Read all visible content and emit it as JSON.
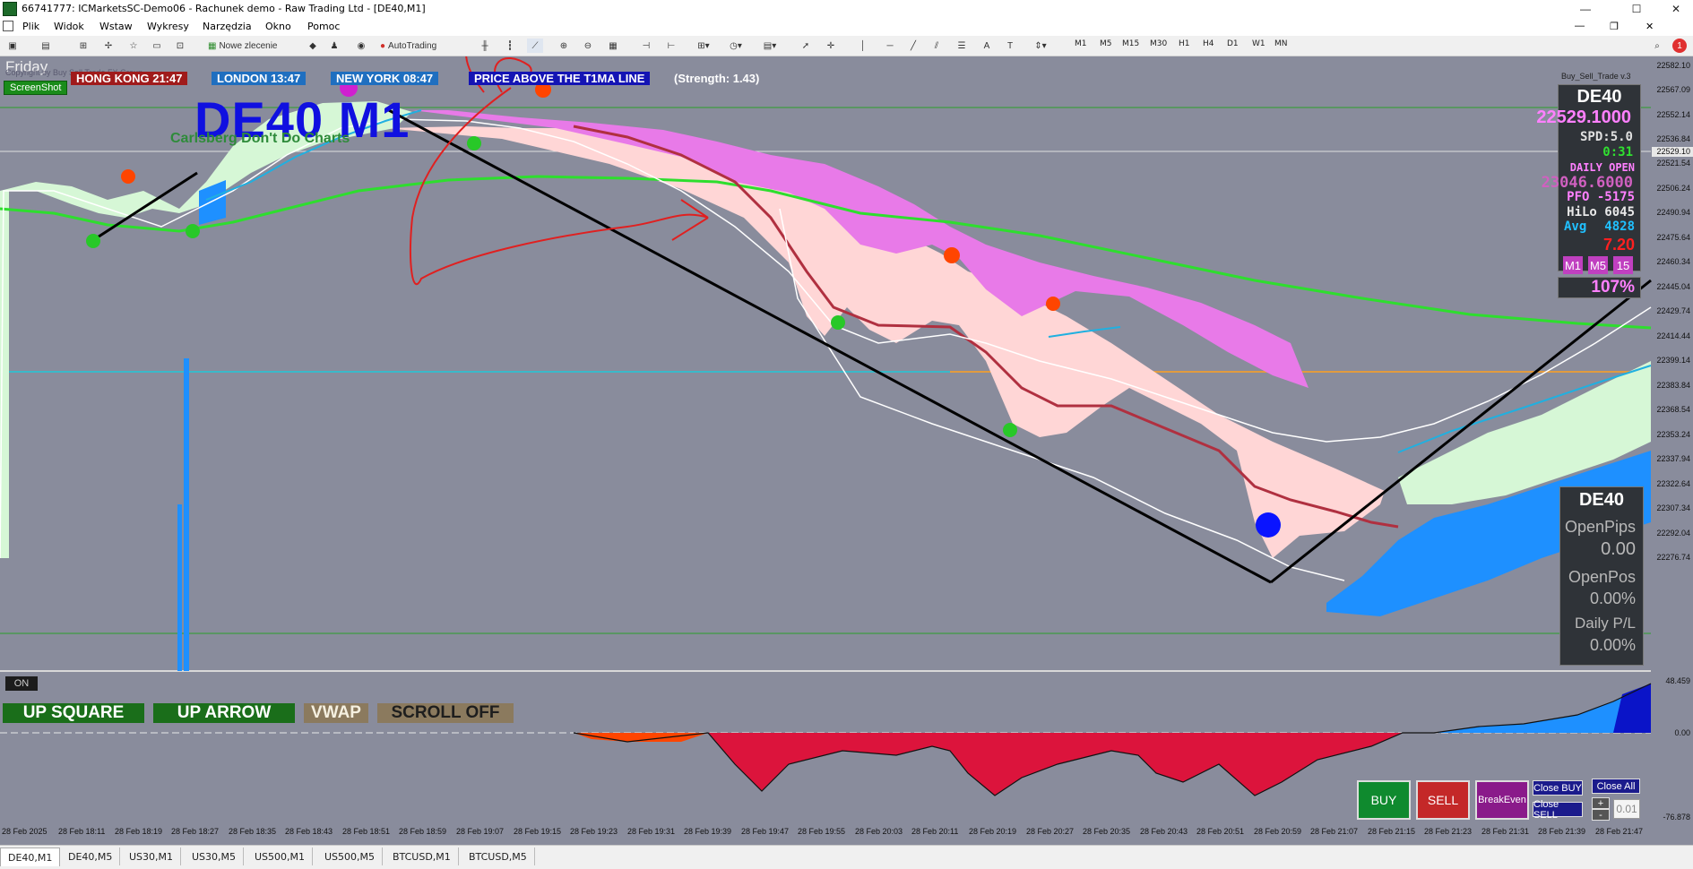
{
  "window": {
    "title": "66741777: ICMarketsSC-Demo06 - Rachunek demo - Raw Trading Ltd - [DE40,M1]",
    "minimize": "—",
    "maximize": "☐",
    "close": "✕"
  },
  "menu": [
    "Plik",
    "Widok",
    "Wstaw",
    "Wykresy",
    "Narzędzia",
    "Okno",
    "Pomoc"
  ],
  "toolbar": {
    "new_order": "Nowe zlecenie",
    "autotrading": "AutoTrading",
    "timeframes": [
      "M1",
      "M5",
      "M15",
      "M30",
      "H1",
      "H4",
      "D1",
      "W1",
      "MN"
    ]
  },
  "chart": {
    "day_label": "Friday",
    "copyright": "Copyright by Buy Sell Trade FX Group",
    "screenshot_btn": "ScreenShot",
    "clocks": [
      {
        "label": "HONG KONG 21:47",
        "color": "#a01b1b"
      },
      {
        "label": "LONDON   13:47",
        "color": "#1f6fc0"
      },
      {
        "label": "NEW YORK  08:47",
        "color": "#1f6fc0"
      },
      {
        "label": "PRICE ABOVE THE T1MA LINE",
        "color": "#1414b4"
      }
    ],
    "strength": "(Strength: 1.43)",
    "indicator_name": "Buy_Sell_Trade v.3",
    "symbol_title": "DE40 M1",
    "slogan": "Carlsberg Don't Do Charts",
    "on_label": "ON",
    "buttons": [
      {
        "label": "UP SQUARE",
        "color": "#1a6e1a"
      },
      {
        "label": "UP ARROW",
        "color": "#1a6e1a"
      },
      {
        "label": "VWAP",
        "color": "#8b7a5e"
      },
      {
        "label": "SCROLL OFF",
        "color": "#8b7a5e"
      }
    ],
    "price_axis": [
      "22582.10",
      "22567.09",
      "22552.14",
      "22536.84",
      "22521.54",
      "22506.24",
      "22490.94",
      "22475.64",
      "22460.34",
      "22445.04",
      "22429.74",
      "22414.44",
      "22399.14",
      "22383.84",
      "22368.54",
      "22353.24",
      "22337.94",
      "22322.64",
      "22307.34",
      "22292.04",
      "22276.74"
    ],
    "current_price_tag": "22529.10",
    "time_axis": [
      "28 Feb 2025",
      "28 Feb 18:11",
      "28 Feb 18:19",
      "28 Feb 18:27",
      "28 Feb 18:35",
      "28 Feb 18:43",
      "28 Feb 18:51",
      "28 Feb 18:59",
      "28 Feb 19:07",
      "28 Feb 19:15",
      "28 Feb 19:23",
      "28 Feb 19:31",
      "28 Feb 19:39",
      "28 Feb 19:47",
      "28 Feb 19:55",
      "28 Feb 20:03",
      "28 Feb 20:11",
      "28 Feb 20:19",
      "28 Feb 20:27",
      "28 Feb 20:35",
      "28 Feb 20:43",
      "28 Feb 20:51",
      "28 Feb 20:59",
      "28 Feb 21:07",
      "28 Feb 21:15",
      "28 Feb 21:23",
      "28 Feb 21:31",
      "28 Feb 21:39",
      "28 Feb 21:47"
    ],
    "oscillator_axis": [
      "48.459",
      "0.00",
      "-76.878"
    ]
  },
  "info_panel": {
    "symbol": "DE40",
    "price": "22529.1000",
    "spread": "SPD:5.0",
    "timer": "0:31",
    "daily_open_label": "DAILY OPEN",
    "daily_open": "23046.6000",
    "pfo": "PFO -5175",
    "hilo": "HiLo 6045",
    "avg_label": "Avg",
    "avg": "4828",
    "ratio": "7.20",
    "tf_buttons": [
      "M1",
      "M5",
      "15"
    ],
    "percent": "107%"
  },
  "position_panel": {
    "symbol": "DE40",
    "open_pips_label": "OpenPips",
    "open_pips": "0.00",
    "open_pos_label": "OpenPos",
    "open_pos": "0.00%",
    "daily_pl_label": "Daily P/L",
    "daily_pl": "0.00%"
  },
  "trade_buttons": {
    "buy": "BUY",
    "sell": "SELL",
    "breakeven": "BreakEven",
    "close_buy": "Close BUY",
    "close_all": "Close All",
    "close_sell": "Close SELL",
    "plus": "+",
    "minus": "-",
    "lot": "0.01"
  },
  "tabs": [
    "DE40,M1",
    "DE40,M5",
    "US30,M1",
    "US30,M5",
    "US500,M1",
    "US500,M5",
    "BTCUSD,M1",
    "BTCUSD,M5"
  ]
}
